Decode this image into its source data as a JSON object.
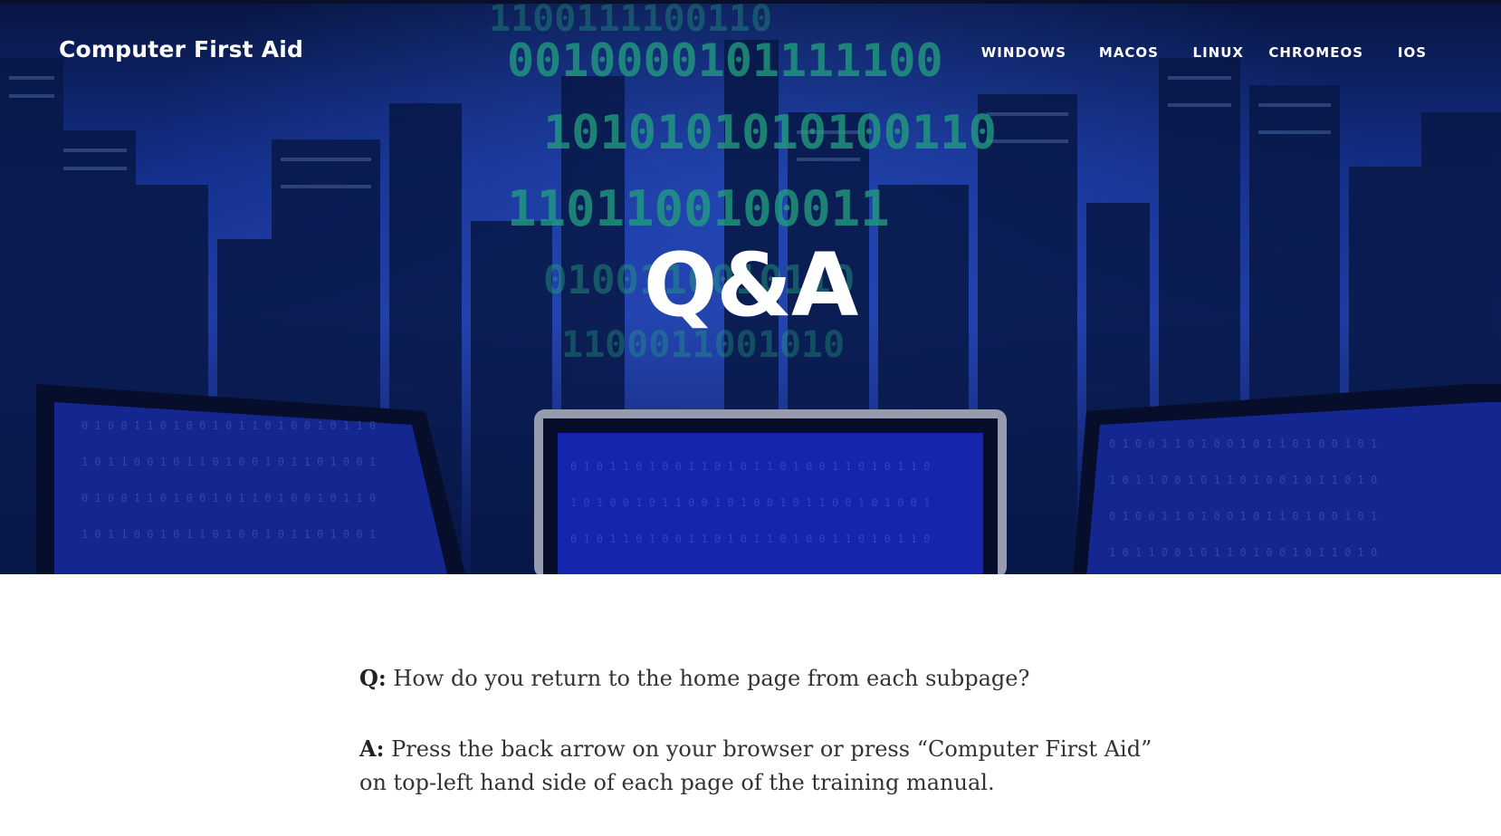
{
  "header": {
    "site_title": "Computer First Aid",
    "nav": [
      {
        "label": "WINDOWS"
      },
      {
        "label": "MACOS"
      },
      {
        "label": "LINUX"
      },
      {
        "label": "CHROMEOS"
      },
      {
        "label": "IOS"
      }
    ]
  },
  "hero": {
    "title": "Q&A"
  },
  "content": {
    "q_prefix": "Q:",
    "q_text": " How do you return to the home page from each subpage?",
    "a_prefix": "A:",
    "a_text": " Press the back arrow on your browser or press “Computer First Aid” on top-left hand side of each page of the training manual."
  },
  "colors": {
    "hero_blue": "#2a4cc8",
    "binary_green": "#2fd39a",
    "text": "#333333"
  }
}
